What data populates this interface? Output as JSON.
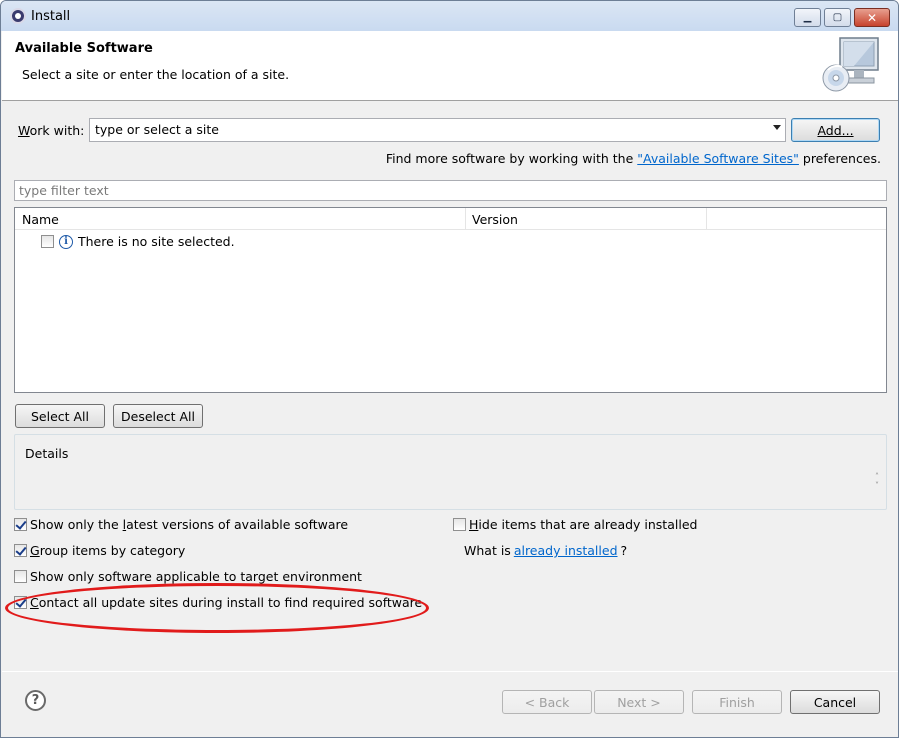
{
  "window": {
    "title": "Install",
    "min_symbol": "▁",
    "max_symbol": "▢",
    "close_symbol": "✕"
  },
  "header": {
    "title": "Available Software",
    "description": "Select a site or enter the location of a site."
  },
  "work_with": {
    "label_prefix": "",
    "label_mnemonic": "W",
    "label_rest": "ork with:",
    "value": "type or select a site",
    "add_button": "Add...",
    "find_more_prefix": "Find more software by working with the ",
    "find_more_link": "\"Available Software Sites\"",
    "find_more_suffix": " preferences."
  },
  "filter": {
    "placeholder": "type filter text"
  },
  "table": {
    "columns": [
      "Name",
      "Version"
    ],
    "rows": [
      {
        "checked": false,
        "icon": "info-icon",
        "name": "There is no site selected."
      }
    ]
  },
  "selection_buttons": {
    "select_all": "Select All",
    "deselect_all": "Deselect All"
  },
  "details": {
    "label": "Details",
    "scroll_up": "˄",
    "scroll_down": "˅"
  },
  "options": {
    "show_latest": {
      "checked": true,
      "pre": "Show only the ",
      "mnemonic": "l",
      "post": "atest versions of available software"
    },
    "group_by_category": {
      "checked": true,
      "pre": "",
      "mnemonic": "G",
      "post": "roup items by category"
    },
    "show_applicable": {
      "checked": false,
      "pre": "Show only software applicable to target environment",
      "mnemonic": "",
      "post": ""
    },
    "contact_all": {
      "checked": true,
      "pre": "",
      "mnemonic": "C",
      "post": "ontact all update sites during install to find required software"
    },
    "hide_installed": {
      "checked": false,
      "pre": "",
      "mnemonic": "H",
      "post": "ide items that are already installed"
    },
    "what_is_prefix": "What is ",
    "what_is_link": "already installed",
    "what_is_suffix": "?"
  },
  "footer": {
    "help_symbol": "?",
    "back": "< Back",
    "next": "Next >",
    "finish": "Finish",
    "cancel": "Cancel"
  },
  "colors": {
    "highlight": "#e11b1b",
    "link": "#0066cc"
  }
}
